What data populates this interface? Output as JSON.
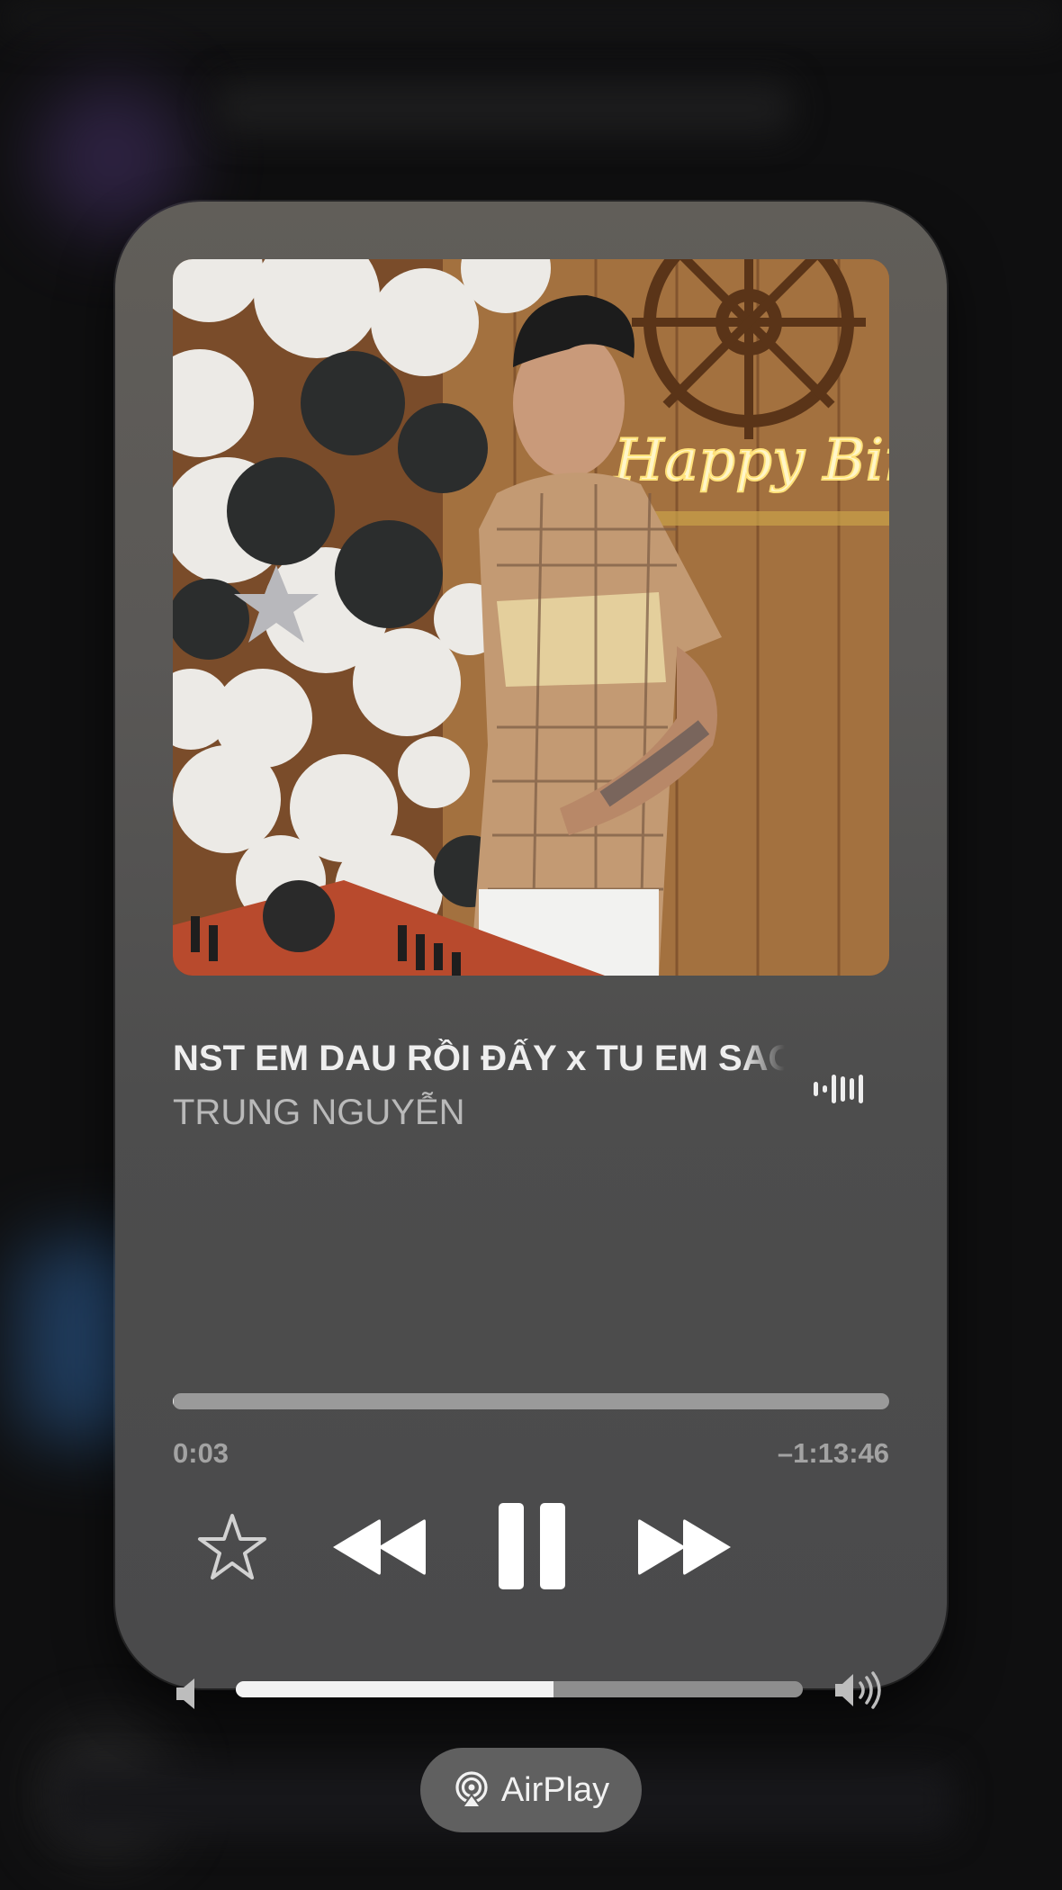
{
  "track": {
    "title": "NST EM DAU RỒI ĐẤY x TU EM SAO",
    "artist": "TRUNG NGUYỄN"
  },
  "playback": {
    "elapsed": "0:03",
    "remaining": "–1:13:46",
    "progress_fraction": 0.001,
    "state": "playing"
  },
  "volume": {
    "level_fraction": 0.56
  },
  "controls": {
    "favorite_icon": "star-icon",
    "rewind_icon": "rewind-icon",
    "pause_icon": "pause-icon",
    "forward_icon": "fast-forward-icon",
    "waveform_icon": "waveform-icon"
  },
  "output": {
    "label": "AirPlay",
    "icon": "airplay-icon"
  },
  "artwork": {
    "neon_text": "Happy Birth"
  },
  "colors": {
    "card_top": "#615e59",
    "card_bottom": "#4a4a4b",
    "primary_text": "#eeeeee",
    "secondary_text": "#b9b9b9"
  }
}
